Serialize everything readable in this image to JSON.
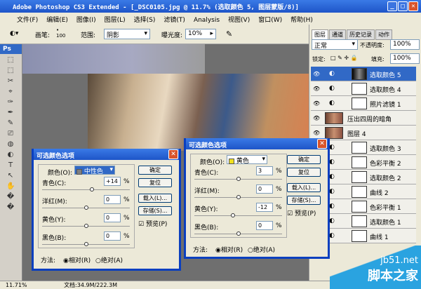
{
  "window": {
    "title": "Adobe Photoshop CS3 Extended - [_DSC0105.jpg @ 11.7% (选取颜色 5, 图层蒙版/8)]"
  },
  "menu": [
    "文件(F)",
    "编辑(E)",
    "图像(I)",
    "图层(L)",
    "选择(S)",
    "滤镜(T)",
    "Analysis",
    "视图(V)",
    "窗口(W)",
    "帮助(H)"
  ],
  "options": {
    "brush_label": "画笔:",
    "brush_size": "100",
    "range_label": "范围:",
    "range_value": "阴影",
    "exposure_label": "曝光度:",
    "exposure_value": "10%"
  },
  "panel": {
    "tabs": [
      "图层",
      "通道",
      "历史记录",
      "动作"
    ],
    "blend_mode": "正常",
    "opacity_label": "不透明度:",
    "opacity": "100%",
    "lock_label": "锁定:",
    "fill_label": "填充:",
    "fill": "100%",
    "layers": [
      {
        "name": "选取颜色 5",
        "selected": true,
        "type": "adj"
      },
      {
        "name": "选取颜色 4",
        "type": "adj"
      },
      {
        "name": "照片滤镜 1",
        "type": "adj"
      },
      {
        "name": "压出四周的暗角",
        "type": "pixel"
      },
      {
        "name": "图层 4",
        "type": "pixel"
      },
      {
        "name": "选取颜色 3",
        "type": "adj"
      },
      {
        "name": "色彩平衡 2",
        "type": "adj"
      },
      {
        "name": "选取颜色 2",
        "type": "adj"
      },
      {
        "name": "曲线 2",
        "type": "adj"
      },
      {
        "name": "色彩平衡 1",
        "type": "adj"
      },
      {
        "name": "选取颜色 1",
        "type": "adj"
      },
      {
        "name": "曲线 1",
        "type": "adj"
      }
    ]
  },
  "dialog1": {
    "title": "可选颜色选项",
    "color_label": "颜色(O):",
    "color_value": "中性色",
    "swatch": "#808080",
    "sliders": [
      {
        "label": "青色(C):",
        "value": "+14",
        "pos": 0.57
      },
      {
        "label": "洋红(M):",
        "value": "0",
        "pos": 0.5
      },
      {
        "label": "黄色(Y):",
        "value": "0",
        "pos": 0.5
      },
      {
        "label": "黑色(B):",
        "value": "0",
        "pos": 0.5
      }
    ],
    "ok": "确定",
    "reset": "复位",
    "load": "载入(L)...",
    "save": "存储(S)...",
    "preview": "预览(P)",
    "method_label": "方法:",
    "relative": "相对(R)",
    "absolute": "绝对(A)"
  },
  "dialog2": {
    "title": "可选颜色选项",
    "color_label": "颜色(O):",
    "color_value": "黄色",
    "swatch": "#f0e020",
    "sliders": [
      {
        "label": "青色(C):",
        "value": "3",
        "pos": 0.5
      },
      {
        "label": "洋红(M):",
        "value": "0",
        "pos": 0.5
      },
      {
        "label": "黄色(Y):",
        "value": "-12",
        "pos": 0.44
      },
      {
        "label": "黑色(B):",
        "value": "0",
        "pos": 0.5
      }
    ],
    "ok": "确定",
    "reset": "复位",
    "load": "载入(L)...",
    "save": "存储(S)...",
    "preview": "预览(P)",
    "method_label": "方法:",
    "relative": "相对(R)",
    "absolute": "绝对(A)"
  },
  "status": {
    "zoom": "11.71%",
    "doc": "文档:34.9M/222.3M"
  },
  "watermark": {
    "site": "jb51.net",
    "name": "脚本之家"
  }
}
